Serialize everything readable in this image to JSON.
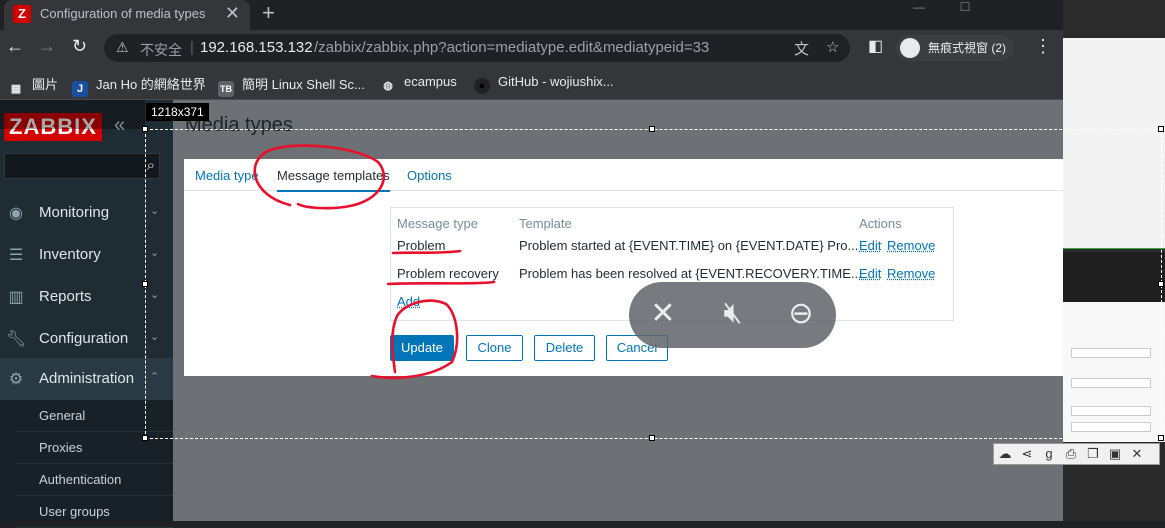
{
  "browser": {
    "tab_title": "Configuration of media types",
    "tab_favicon": "Z",
    "new_tab": "+",
    "close_tab": "✕",
    "insecure_label": "不安全",
    "url_host": "192.168.153.132",
    "url_path": "/zabbix/zabbix.php?action=mediatype.edit&mediatypeid=33",
    "incognito_label": "無痕式視窗 (2)",
    "bookmarks": [
      {
        "label": "圖片",
        "icon": "grid-icon"
      },
      {
        "label": "Jan Ho 的網絡世界",
        "icon": "J"
      },
      {
        "label": "簡明 Linux Shell Sc...",
        "icon": "TB"
      },
      {
        "label": "ecampus",
        "icon": "globe-icon"
      },
      {
        "label": "GitHub - wojiushix...",
        "icon": "github-icon"
      }
    ]
  },
  "sidebar": {
    "logo": "ZABBIX",
    "menu": [
      {
        "label": "Monitoring",
        "icon": "eye-icon"
      },
      {
        "label": "Inventory",
        "icon": "list-icon"
      },
      {
        "label": "Reports",
        "icon": "chart-icon"
      },
      {
        "label": "Configuration",
        "icon": "wrench-icon"
      },
      {
        "label": "Administration",
        "icon": "gear-icon"
      }
    ],
    "submenu": [
      "General",
      "Proxies",
      "Authentication",
      "User groups"
    ]
  },
  "main": {
    "page_title": "Media types",
    "tabs": [
      "Media type",
      "Message templates",
      "Options"
    ],
    "active_tab": "Message templates",
    "table": {
      "headers": [
        "Message type",
        "Template",
        "Actions"
      ],
      "rows": [
        {
          "type": "Problem",
          "template": "Problem started at {EVENT.TIME} on {EVENT.DATE} Pro...",
          "edit": "Edit",
          "remove": "Remove"
        },
        {
          "type": "Problem recovery",
          "template": "Problem has been resolved at {EVENT.RECOVERY.TIME...",
          "edit": "Edit",
          "remove": "Remove"
        }
      ],
      "add": "Add"
    },
    "buttons": {
      "update": "Update",
      "clone": "Clone",
      "delete": "Delete",
      "cancel": "Cancel"
    }
  },
  "overlay": {
    "selection_size": "1218x371"
  },
  "colors": {
    "zabbix_red": "#d40000",
    "link_blue": "#0275b8",
    "annotation_red": "#e8112d"
  }
}
